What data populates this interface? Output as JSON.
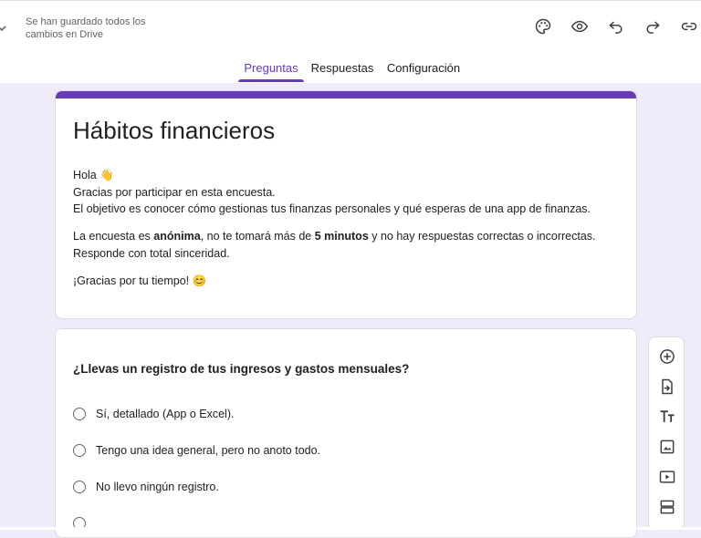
{
  "header": {
    "save_status": "Se han guardado todos los cambios en Drive",
    "toolbar_icons": [
      "palette-icon",
      "eye-icon",
      "undo-icon",
      "redo-icon",
      "link-icon"
    ]
  },
  "tabs": [
    {
      "label": "Preguntas",
      "active": true
    },
    {
      "label": "Respuestas",
      "active": false
    },
    {
      "label": "Configuración",
      "active": false
    }
  ],
  "form": {
    "title": "Hábitos financieros",
    "description": {
      "greeting": "Hola 👋",
      "line2": "Gracias por participar en esta encuesta.",
      "line3": "El objetivo es conocer cómo gestionas tus finanzas personales y qué esperas de una app de finanzas.",
      "para2_a": "La encuesta es ",
      "para2_b": "anónima",
      "para2_c": ", no te tomará más de ",
      "para2_d": "5 minutos",
      "para2_e": " y no hay respuestas correctas o incorrectas.",
      "para2_line2": "Responde con total sinceridad.",
      "thanks": "¡Gracias por tu tiempo! 😊"
    }
  },
  "question": {
    "title": "¿Llevas un registro de tus ingresos y gastos mensuales?",
    "options": [
      "Sí, detallado (App o Excel).",
      "Tengo una idea general, pero no anoto todo.",
      "No llevo ningún registro."
    ]
  },
  "side_toolbar": [
    "add-question-icon",
    "import-questions-icon",
    "add-title-icon",
    "add-image-icon",
    "add-video-icon",
    "add-section-icon"
  ],
  "colors": {
    "accent": "#673ab7",
    "background": "#efebf8"
  }
}
